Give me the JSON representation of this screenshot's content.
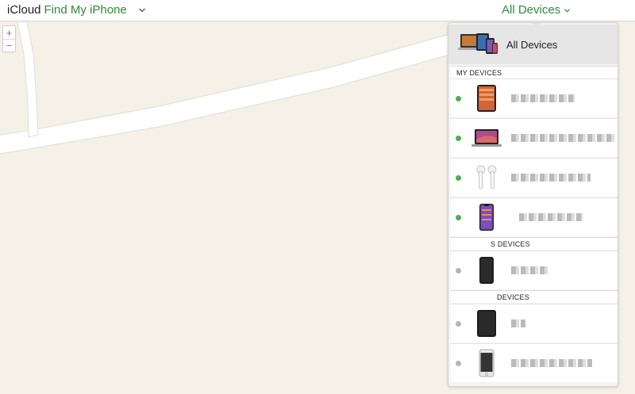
{
  "header": {
    "icloud": "iCloud",
    "app_name": "Find My iPhone",
    "devices_menu": "All Devices"
  },
  "colors": {
    "accent_green": "#2e8b3a",
    "online_dot": "#4caf50",
    "offline_dot": "#b5b5b5",
    "map_bg": "#f5f1e8"
  },
  "map": {
    "zoom_in": "+",
    "zoom_out": "−"
  },
  "panel": {
    "all_devices_label": "All Devices",
    "sections": [
      {
        "title": "MY DEVICES"
      },
      {
        "title": "S DEVICES"
      },
      {
        "title": "DEVICES"
      }
    ],
    "devices": [
      {
        "type": "ipad-icon",
        "status": "online"
      },
      {
        "type": "macbook-icon",
        "status": "online"
      },
      {
        "type": "airpods-icon",
        "status": "online"
      },
      {
        "type": "iphone-icon",
        "status": "online"
      },
      {
        "type": "iphone-black-icon",
        "status": "offline"
      },
      {
        "type": "ipad-black-icon",
        "status": "offline"
      },
      {
        "type": "iphone-white-icon",
        "status": "offline"
      }
    ]
  }
}
